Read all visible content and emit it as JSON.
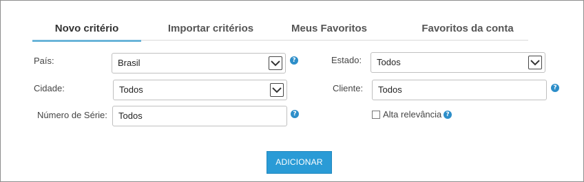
{
  "tabs": [
    {
      "label": "Novo critério",
      "active": true
    },
    {
      "label": "Importar critérios",
      "active": false
    },
    {
      "label": "Meus Favoritos",
      "active": false
    },
    {
      "label": "Favoritos da conta",
      "active": false
    }
  ],
  "form": {
    "pais": {
      "label": "País:",
      "value": "Brasil"
    },
    "estado": {
      "label": "Estado:",
      "value": "Todos"
    },
    "cidade": {
      "label": "Cidade:",
      "value": "Todos"
    },
    "cliente": {
      "label": "Cliente:",
      "value": "Todos"
    },
    "numero_serie": {
      "label": "Número de Série:",
      "value": "Todos"
    },
    "alta_relevancia": {
      "label": "Alta relevância",
      "checked": false
    }
  },
  "help_glyph": "?",
  "add_button": {
    "label": "ADICIONAR"
  },
  "colors": {
    "accent": "#2a9bd6",
    "tab_underline": "#69b4d9",
    "help_icon": "#2d8ec9"
  }
}
